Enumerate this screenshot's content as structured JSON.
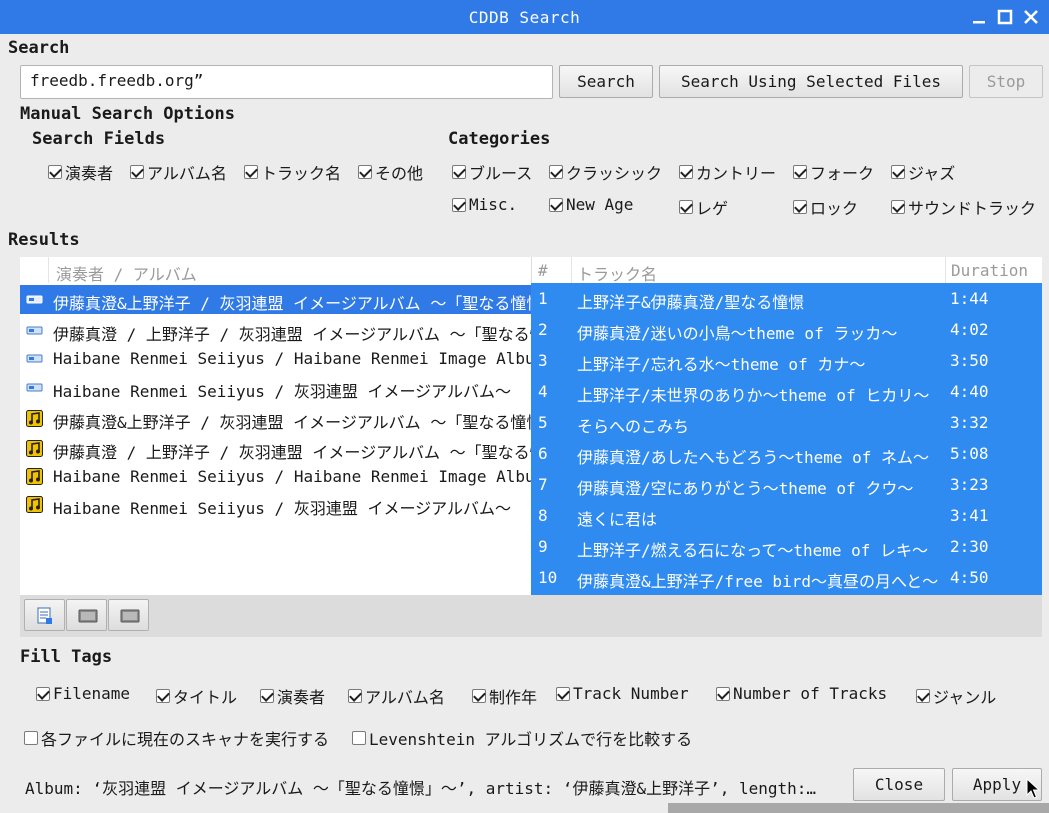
{
  "window": {
    "title": "CDDB Search"
  },
  "search": {
    "section_label": "Search",
    "server_value": "freedb.freedb.org”",
    "search_label": "Search",
    "search_selected_label": "Search Using Selected Files",
    "stop_label": "Stop"
  },
  "manual": {
    "label": "Manual Search Options",
    "fields_label": "Search Fields",
    "fields": [
      {
        "label": "演奏者",
        "checked": true
      },
      {
        "label": "アルバム名",
        "checked": true
      },
      {
        "label": "トラック名",
        "checked": true
      },
      {
        "label": "その他",
        "checked": true
      }
    ],
    "categories_label": "Categories",
    "categories": [
      {
        "label": "ブルース",
        "checked": true
      },
      {
        "label": "クラッシック",
        "checked": true
      },
      {
        "label": "カントリー",
        "checked": true
      },
      {
        "label": "フォーク",
        "checked": true
      },
      {
        "label": "ジャズ",
        "checked": true
      },
      {
        "label": "Misc.",
        "checked": true
      },
      {
        "label": "New Age",
        "checked": true
      },
      {
        "label": "レゲ",
        "checked": true
      },
      {
        "label": "ロック",
        "checked": true
      },
      {
        "label": "サウンドトラック",
        "checked": true
      }
    ]
  },
  "results": {
    "label": "Results",
    "album_header": "演奏者 / アルバム",
    "albums": [
      {
        "text": "伊藤真澄&上野洋子 / 灰羽連盟 イメージアルバム ～「聖なる憧憬」～",
        "icon": "cd-icon",
        "selected": true
      },
      {
        "text": "伊藤真澄 / 上野洋子 / 灰羽連盟 イメージアルバム ～「聖なる憧憬」～",
        "icon": "cd-icon",
        "selected": false
      },
      {
        "text": "Haibane Renmei Seiiyus / Haibane Renmei Image Album",
        "icon": "cd-icon",
        "selected": false
      },
      {
        "text": "Haibane Renmei Seiiyus / 灰羽連盟 イメージアルバム～",
        "icon": "cd-icon",
        "selected": false
      },
      {
        "text": "伊藤真澄&上野洋子 / 灰羽連盟 イメージアルバム ～「聖なる憧憬」～",
        "icon": "music-note-icon",
        "selected": false
      },
      {
        "text": "伊藤真澄 / 上野洋子 / 灰羽連盟 イメージアルバム ～「聖なる憧憬」～",
        "icon": "music-note-icon",
        "selected": false
      },
      {
        "text": "Haibane Renmei Seiiyus / Haibane Renmei Image Album",
        "icon": "music-note-icon",
        "selected": false
      },
      {
        "text": "Haibane Renmei Seiiyus / 灰羽連盟 イメージアルバム～",
        "icon": "music-note-icon",
        "selected": false
      }
    ],
    "track_headers": {
      "num": "#",
      "name": "トラック名",
      "duration": "Duration"
    },
    "tracks": [
      {
        "num": "1",
        "name": "上野洋子&伊藤真澄/聖なる憧憬",
        "duration": "1:44"
      },
      {
        "num": "2",
        "name": "伊藤真澄/迷いの小鳥～theme of ラッカ～",
        "duration": "4:02"
      },
      {
        "num": "3",
        "name": "上野洋子/忘れる水～theme of カナ～",
        "duration": "3:50"
      },
      {
        "num": "4",
        "name": "上野洋子/未世界のありか～theme of ヒカリ～",
        "duration": "4:40"
      },
      {
        "num": "5",
        "name": "そらへのこみち",
        "duration": "3:32"
      },
      {
        "num": "6",
        "name": "伊藤真澄/あしたへもどろう～theme of ネム～",
        "duration": "5:08"
      },
      {
        "num": "7",
        "name": "伊藤真澄/空にありがとう～theme of クウ～",
        "duration": "3:23"
      },
      {
        "num": "8",
        "name": "遠くに君は",
        "duration": "3:41"
      },
      {
        "num": "9",
        "name": "上野洋子/燃える石になって～theme of レキ～",
        "duration": "2:30"
      },
      {
        "num": "10",
        "name": "伊藤真澄&上野洋子/free bird～真昼の月へと～",
        "duration": "4:50"
      }
    ]
  },
  "fill": {
    "label": "Fill Tags",
    "tags": [
      {
        "label": "Filename",
        "checked": true
      },
      {
        "label": "タイトル",
        "checked": true
      },
      {
        "label": "演奏者",
        "checked": true
      },
      {
        "label": "アルバム名",
        "checked": true
      },
      {
        "label": "制作年",
        "checked": true
      },
      {
        "label": "Track Number",
        "checked": true
      },
      {
        "label": "Number of Tracks",
        "checked": true
      },
      {
        "label": "ジャンル",
        "checked": true
      }
    ],
    "run_scanner": {
      "label": "各ファイルに現在のスキャナを実行する",
      "checked": false
    },
    "levenshtein": {
      "label": "Levenshtein アルゴリズムで行を比較する",
      "checked": false
    }
  },
  "status": {
    "text": "Album: ‘灰羽連盟 イメージアルバム ～「聖なる憧憬」～’, artist: ‘伊藤真澄&上野洋子’, length:…",
    "close_label": "Close",
    "apply_label": "Apply"
  }
}
